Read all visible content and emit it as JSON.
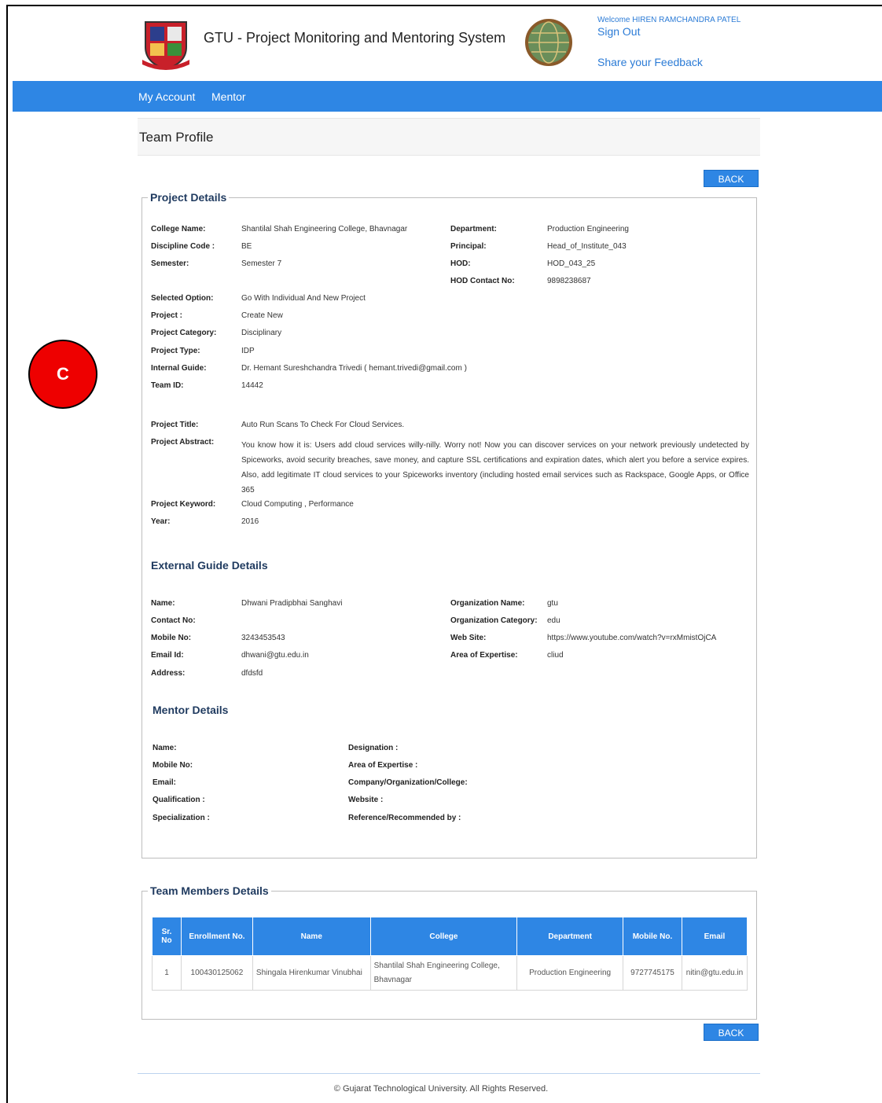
{
  "header": {
    "app_title": "GTU - Project Monitoring and Mentoring System",
    "welcome": "Welcome HIREN RAMCHANDRA PATEL",
    "sign_out": "Sign Out",
    "feedback": "Share your Feedback"
  },
  "nav": {
    "items": [
      "My Account",
      "Mentor"
    ]
  },
  "page": {
    "title": "Team Profile",
    "back_label": "BACK",
    "marker_label": "C"
  },
  "project": {
    "legend": "Project Details",
    "college_name_label": "College Name:",
    "college_name": "Shantilal Shah Engineering College, Bhavnagar",
    "discipline_label": "Discipline Code :",
    "discipline": "BE",
    "semester_label": "Semester:",
    "semester": "Semester 7",
    "department_label": "Department:",
    "department": "Production Engineering",
    "principal_label": "Principal:",
    "principal": "Head_of_Institute_043",
    "hod_label": "HOD:",
    "hod": "HOD_043_25",
    "hod_contact_label": "HOD Contact No:",
    "hod_contact": "9898238687",
    "selected_option_label": "Selected Option:",
    "selected_option": "Go With Individual And New Project",
    "project_label": "Project :",
    "project": "Create New",
    "category_label": "Project Category:",
    "category": "Disciplinary",
    "type_label": "Project Type:",
    "type": "IDP",
    "guide_label": "Internal Guide:",
    "guide": "Dr. Hemant Sureshchandra Trivedi ( hemant.trivedi@gmail.com )",
    "team_id_label": "Team ID:",
    "team_id": "14442",
    "title_label": "Project Title:",
    "title": "Auto Run Scans To Check For Cloud Services.",
    "abstract_label": "Project Abstract:",
    "abstract": "You know how it is: Users add cloud services willy-nilly. Worry not! Now you can discover services on your network previously undetected by Spiceworks, avoid security breaches, save money, and capture SSL certifications and expiration dates, which alert you before a service expires. Also, add legitimate IT cloud services to your Spiceworks inventory (including hosted email services such as Rackspace, Google Apps, or Office 365",
    "keyword_label": "Project Keyword:",
    "keyword": "Cloud Computing , Performance",
    "year_label": "Year:",
    "year": "2016"
  },
  "external_guide": {
    "heading": "External Guide Details",
    "name_label": "Name:",
    "name": "Dhwani Pradipbhai Sanghavi",
    "contact_label": "Contact No:",
    "contact": "",
    "mobile_label": "Mobile No:",
    "mobile": "3243453543",
    "email_label": "Email Id:",
    "email": "dhwani@gtu.edu.in",
    "address_label": "Address:",
    "address": "dfdsfd",
    "org_name_label": "Organization Name:",
    "org_name": "gtu",
    "org_category_label": "Organization Category:",
    "org_category": "edu",
    "website_label": "Web Site:",
    "website": "https://www.youtube.com/watch?v=rxMmistOjCA",
    "expertise_label": "Area of Expertise:",
    "expertise": "cliud"
  },
  "mentor": {
    "heading": "Mentor Details",
    "name_label": "Name:",
    "mobile_label": "Mobile No:",
    "email_label": "Email:",
    "qualification_label": "Qualification :",
    "specialization_label": "Specialization :",
    "designation_label": "Designation :",
    "expertise_label": "Area of Expertise :",
    "company_label": "Company/Organization/College:",
    "website_label": "Website :",
    "reference_label": "Reference/Recommended by :"
  },
  "team": {
    "legend": "Team Members Details",
    "columns": [
      "Sr. No",
      "Enrollment No.",
      "Name",
      "College",
      "Department",
      "Mobile No.",
      "Email"
    ],
    "rows": [
      [
        "1",
        "100430125062",
        "Shingala Hirenkumar Vinubhai",
        "Shantilal Shah Engineering College, Bhavnagar",
        "Production Engineering",
        "9727745175",
        "nitin@gtu.edu.in"
      ]
    ]
  },
  "footer": {
    "text": "© Gujarat Technological University. All Rights Reserved."
  }
}
